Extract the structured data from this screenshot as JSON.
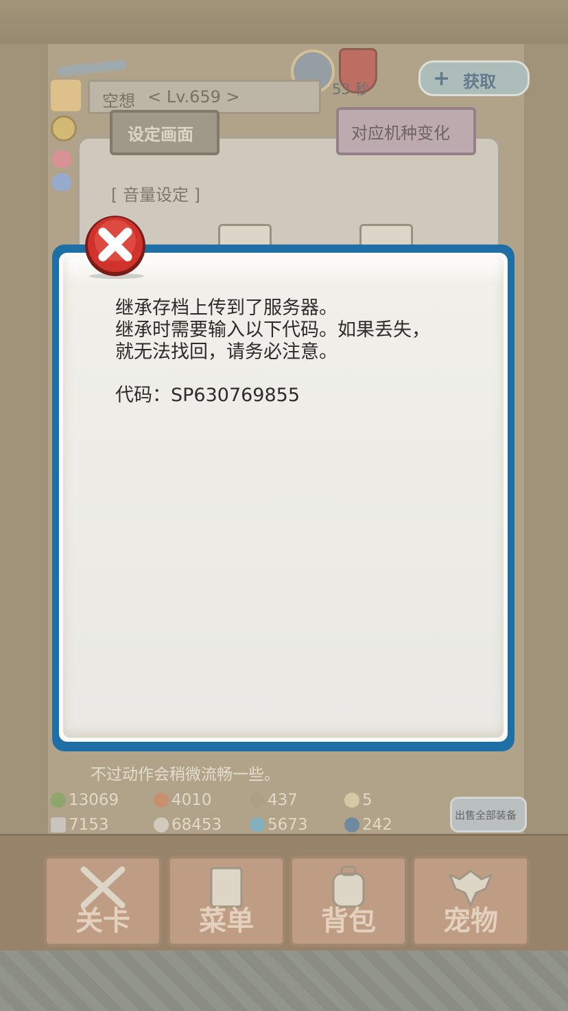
{
  "background": {
    "player_name": "空想",
    "player_level": "< Lv.659 >",
    "timer": "53 秒",
    "top_right_button": "获取",
    "tab_settings": "设定画面",
    "tab_device": "对应机种变化",
    "volume_label": "[ 音量设定 ]",
    "bg_text_line": "不过动作会稍微流畅一些。",
    "resources": [
      "13069",
      "4010",
      "437",
      "5",
      "7153",
      "68453",
      "5673",
      "242"
    ],
    "sell_all_button": "出售全部装备",
    "nav": [
      "关卡",
      "菜单",
      "背包",
      "宠物"
    ]
  },
  "dialog": {
    "lines": [
      "继承存档上传到了服务器。",
      "继承时需要输入以下代码。如果丢失，",
      "就无法找回，请务必注意。"
    ],
    "code_line": "代码：SP630769855"
  },
  "colors": {
    "dialog_border": "#1d6fa6",
    "close_icon_red": "#d0322c"
  }
}
